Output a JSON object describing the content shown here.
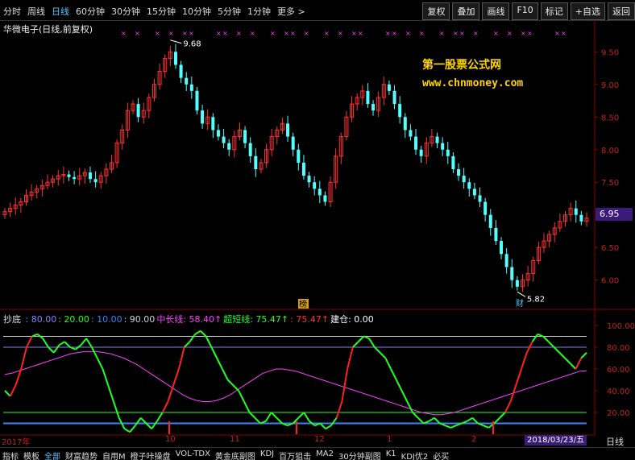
{
  "periods": [
    "分时",
    "周线",
    "日线",
    "60分钟",
    "30分钟",
    "15分钟",
    "10分钟",
    "5分钟",
    "1分钟",
    "更多 >"
  ],
  "active_period": "日线",
  "toolbar": [
    "复权",
    "叠加",
    "画线",
    "F10",
    "标记",
    "+自选",
    "返回"
  ],
  "stock_title": "华微电子(日线,前复权)",
  "watermark": {
    "line1": "第一股票公式网",
    "line2": "www.chnmoney.com"
  },
  "price_axis": [
    "9.50",
    "9.00",
    "8.50",
    "8.00",
    "7.50",
    "7.00",
    "6.50",
    "6.00"
  ],
  "current_price": "6.95",
  "high_label": "9.68",
  "low_label": "5.82",
  "marker_cai": "财",
  "marker_bang": "榜",
  "indicator": {
    "name": "抄底",
    "items": [
      {
        "text": ": 80.00",
        "color": "#8080ff"
      },
      {
        "text": ": 20.00",
        "color": "#20ff20"
      },
      {
        "text": ": 10.00",
        "color": "#4080ff"
      },
      {
        "text": ": 90.00",
        "color": "#d0d0d0"
      },
      {
        "text": "中长线: 58.40↑",
        "color": "#ff40ff"
      },
      {
        "text": "超短线: 75.47↑",
        "color": "#20ff20"
      },
      {
        "text": ": 75.47↑",
        "color": "#ff3030"
      },
      {
        "text": "建仓: 0.00",
        "color": "#ffffff"
      }
    ]
  },
  "indicator_axis": [
    "100.00",
    "80.00",
    "60.00",
    "40.00",
    "20.00"
  ],
  "date_labels": [
    "2017年",
    "10",
    "11",
    "12",
    "1",
    "2"
  ],
  "current_date": "2018/03/23/五",
  "period_label": "日线",
  "bottom_tabs": [
    "指标",
    "模板",
    "全部",
    "财富趋势",
    "自用M",
    "橙子咔操盘",
    "VOL-TDX",
    "黄金底副图",
    "KDJ",
    "百万狙击",
    "MA2",
    "30分钟副图",
    "K1",
    "KDJ优2",
    "必买"
  ],
  "active_bottom_tab": "全部",
  "colors": {
    "up": "#ff3232",
    "down": "#54ffff",
    "grid": "#8b0000",
    "accent": "#56c8ff"
  },
  "chart_data": {
    "type": "candlestick",
    "price_range": [
      5.7,
      9.8
    ],
    "high": 9.68,
    "low": 5.82,
    "last": 6.95,
    "close": [
      7.05,
      7.1,
      7.15,
      7.2,
      7.3,
      7.35,
      7.4,
      7.45,
      7.5,
      7.55,
      7.6,
      7.62,
      7.58,
      7.55,
      7.6,
      7.65,
      7.55,
      7.5,
      7.6,
      7.7,
      7.8,
      8.1,
      8.3,
      8.6,
      8.7,
      8.5,
      8.6,
      8.8,
      9.0,
      9.2,
      9.4,
      9.5,
      9.3,
      9.1,
      9.0,
      8.9,
      8.6,
      8.4,
      8.5,
      8.3,
      8.2,
      8.1,
      8.0,
      8.2,
      8.3,
      8.1,
      7.9,
      7.7,
      7.8,
      8.0,
      8.2,
      8.3,
      8.4,
      8.2,
      8.0,
      7.8,
      7.6,
      7.5,
      7.4,
      7.3,
      7.2,
      7.5,
      7.9,
      8.2,
      8.5,
      8.7,
      8.8,
      8.9,
      8.7,
      8.6,
      8.8,
      9.0,
      8.9,
      8.7,
      8.5,
      8.3,
      8.2,
      8.0,
      7.9,
      8.1,
      8.2,
      8.1,
      8.0,
      7.9,
      7.7,
      7.6,
      7.5,
      7.4,
      7.3,
      7.2,
      7.0,
      6.8,
      6.6,
      6.4,
      6.2,
      6.0,
      5.9,
      6.0,
      6.1,
      6.3,
      6.5,
      6.6,
      6.7,
      6.8,
      6.9,
      7.0,
      7.1,
      7.0,
      6.9,
      6.95
    ],
    "oscillator": [
      40,
      35,
      45,
      60,
      80,
      90,
      92,
      88,
      80,
      75,
      82,
      85,
      80,
      78,
      82,
      88,
      80,
      70,
      60,
      45,
      30,
      15,
      5,
      2,
      8,
      15,
      10,
      5,
      12,
      20,
      30,
      45,
      60,
      80,
      85,
      92,
      95,
      90,
      80,
      70,
      60,
      50,
      45,
      40,
      30,
      20,
      15,
      10,
      12,
      20,
      15,
      10,
      8,
      10,
      15,
      20,
      12,
      8,
      10,
      5,
      8,
      15,
      30,
      60,
      80,
      85,
      90,
      88,
      80,
      75,
      70,
      60,
      50,
      40,
      30,
      20,
      15,
      10,
      12,
      15,
      10,
      8,
      6,
      8,
      10,
      12,
      15,
      10,
      8,
      6,
      10,
      15,
      20,
      30,
      45,
      60,
      75,
      85,
      92,
      90,
      85,
      80,
      75,
      70,
      65,
      60,
      70,
      75
    ],
    "long_line": [
      55,
      56,
      58,
      60,
      62,
      64,
      66,
      68,
      70,
      72,
      74,
      75,
      76,
      76,
      76,
      75,
      74,
      72,
      70,
      67,
      64,
      60,
      56,
      52,
      48,
      44,
      40,
      36,
      33,
      31,
      30,
      30,
      31,
      33,
      36,
      40,
      44,
      48,
      52,
      56,
      58,
      60,
      60,
      59,
      58,
      56,
      54,
      52,
      50,
      48,
      46,
      44,
      42,
      40,
      38,
      36,
      34,
      32,
      30,
      28,
      26,
      24,
      22,
      20,
      19,
      18,
      18,
      19,
      20,
      22,
      24,
      26,
      28,
      30,
      32,
      34,
      36,
      38,
      40,
      42,
      44,
      46,
      48,
      50,
      52,
      54,
      56,
      58,
      58.4
    ]
  }
}
